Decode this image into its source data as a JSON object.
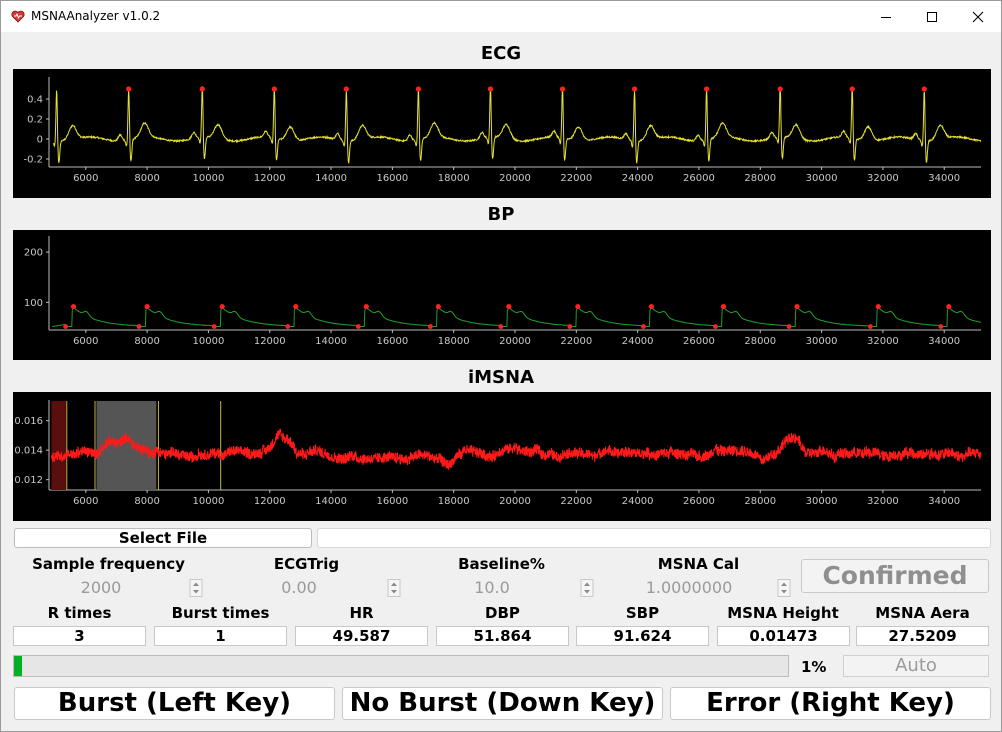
{
  "window": {
    "title": "MSNAAnalyzer v1.0.2",
    "icon": "app-heart-icon",
    "controls": [
      "minimize-icon",
      "maximize-icon",
      "close-icon"
    ]
  },
  "plots": {
    "ecg": {
      "title": "ECG",
      "y_ticks": [
        "0.4",
        "0.2",
        "0",
        "-0.2"
      ]
    },
    "bp": {
      "title": "BP",
      "y_ticks": [
        "200",
        "100"
      ]
    },
    "imsna": {
      "title": "iMSNA",
      "y_ticks": [
        "0.016",
        "0.014",
        "0.012"
      ]
    },
    "x_ticks": [
      "6000",
      "8000",
      "10000",
      "12000",
      "14000",
      "16000",
      "18000",
      "20000",
      "22000",
      "24000",
      "26000",
      "28000",
      "30000",
      "32000",
      "34000"
    ],
    "colors": {
      "ecg": "#e6e22e",
      "bp": "#1f9e2b",
      "imsna": "#ff1a1a",
      "markers": "#ff2020",
      "background": "#000000"
    }
  },
  "chart_data": [
    {
      "type": "line",
      "title": "ECG",
      "xlim": [
        4800,
        35200
      ],
      "ylim": [
        -0.28,
        0.62
      ],
      "y_ticks": [
        0.4,
        0.2,
        0,
        -0.2
      ],
      "x_ticks": [
        6000,
        8000,
        10000,
        12000,
        14000,
        16000,
        18000,
        20000,
        22000,
        24000,
        26000,
        28000,
        30000,
        32000,
        34000
      ],
      "r_peaks_x": [
        7400,
        9800,
        12150,
        14500,
        16850,
        19200,
        21550,
        23900,
        26250,
        28650,
        31000,
        33350
      ],
      "r_peak_y": 0.5
    },
    {
      "type": "line",
      "title": "BP",
      "xlim": [
        4800,
        35200
      ],
      "ylim": [
        45,
        232
      ],
      "y_ticks": [
        200,
        100
      ],
      "x_ticks": [
        6000,
        8000,
        10000,
        12000,
        14000,
        16000,
        18000,
        20000,
        22000,
        24000,
        26000,
        28000,
        30000,
        32000,
        34000
      ],
      "sbp_x": [
        5600,
        8000,
        10450,
        12850,
        15150,
        17500,
        19800,
        22050,
        24450,
        26800,
        29200,
        31850,
        34150
      ],
      "sbp_y": 91.624,
      "dbp_y": 51.864
    },
    {
      "type": "line",
      "title": "iMSNA",
      "xlim": [
        4800,
        35200
      ],
      "ylim": [
        0.0113,
        0.0174
      ],
      "y_ticks": [
        0.016,
        0.014,
        0.012
      ],
      "x_ticks": [
        6000,
        8000,
        10000,
        12000,
        14000,
        16000,
        18000,
        20000,
        22000,
        24000,
        26000,
        28000,
        30000,
        32000,
        34000
      ],
      "burst_window": [
        6350,
        8300
      ],
      "error_window": [
        4880,
        5350
      ],
      "markers_x": [
        5380,
        6300,
        8370,
        10400
      ]
    }
  ],
  "controls": {
    "select_file": "Select File",
    "file_path": "",
    "sample_frequency_label": "Sample frequency",
    "sample_frequency_value": "2000",
    "ecgtrig_label": "ECGTrig",
    "ecgtrig_value": "0.00",
    "baseline_label": "Baseline%",
    "baseline_value": "10.0",
    "msna_cal_label": "MSNA Cal",
    "msna_cal_value": "1.0000000",
    "confirmed": "Confirmed"
  },
  "stats": {
    "r_times_label": "R times",
    "r_times": "3",
    "burst_times_label": "Burst times",
    "burst_times": "1",
    "hr_label": "HR",
    "hr": "49.587",
    "dbp_label": "DBP",
    "dbp": "51.864",
    "sbp_label": "SBP",
    "sbp": "91.624",
    "msna_height_label": "MSNA Height",
    "msna_height": "0.01473",
    "msna_aera_label": "MSNA Aera",
    "msna_aera": "27.5209"
  },
  "progress": {
    "value": 0.01,
    "text": "1%"
  },
  "auto_button": "Auto",
  "buttons": {
    "burst": "Burst (Left Key)",
    "no_burst": "No Burst (Down Key)",
    "error": "Error (Right Key)"
  }
}
